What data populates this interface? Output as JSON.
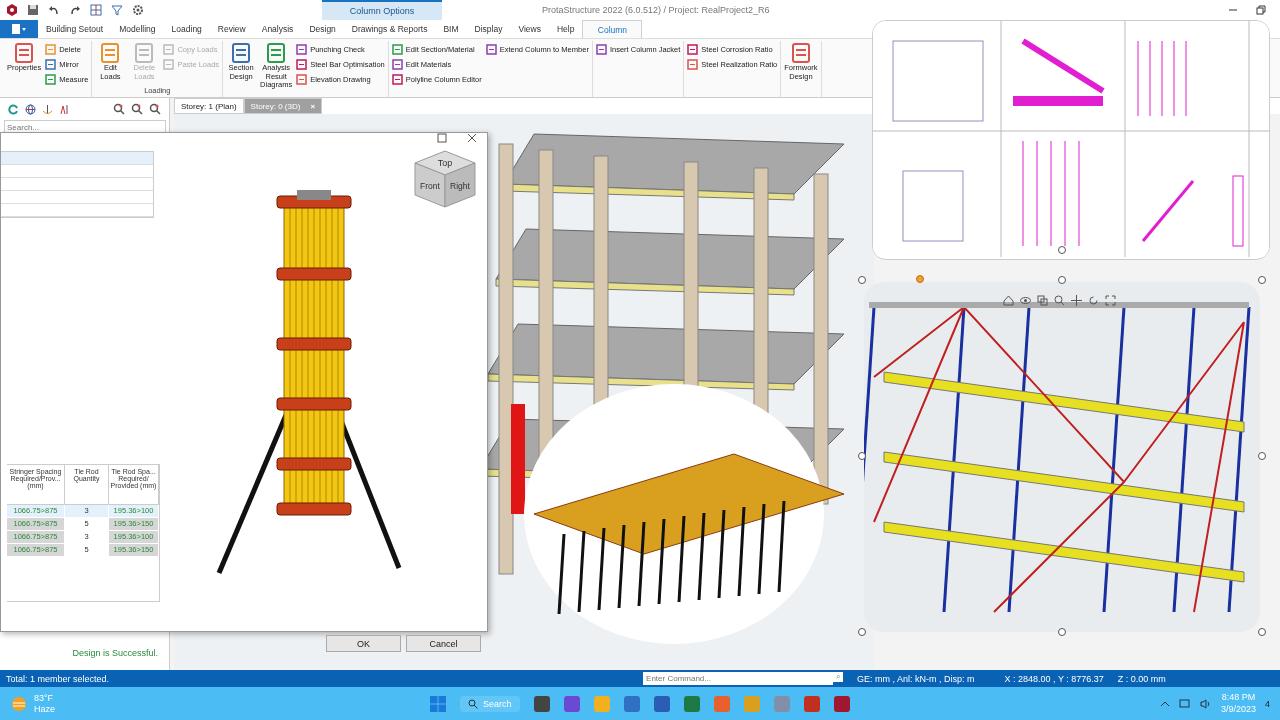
{
  "title_bar": {
    "context_header": "Column Options",
    "title": "ProtaStructure 2022 (6.0.512) / Project: RealProject2_R6"
  },
  "tabs": [
    {
      "label": "Building Setout",
      "selected": false
    },
    {
      "label": "Modelling",
      "selected": false
    },
    {
      "label": "Loading",
      "selected": false
    },
    {
      "label": "Review",
      "selected": false
    },
    {
      "label": "Analysis",
      "selected": false
    },
    {
      "label": "Design",
      "selected": false
    },
    {
      "label": "Drawings & Reports",
      "selected": false
    },
    {
      "label": "BIM",
      "selected": false
    },
    {
      "label": "Display",
      "selected": false
    },
    {
      "label": "Views",
      "selected": false
    },
    {
      "label": "Help",
      "selected": false
    },
    {
      "label": "Column",
      "selected": true
    }
  ],
  "ribbon": {
    "groups": [
      {
        "columns": [
          {
            "kind": "large",
            "items": [
              {
                "label": "Properties",
                "disabled": false
              }
            ]
          },
          {
            "kind": "stack",
            "items": [
              {
                "label": "Delete",
                "disabled": false
              },
              {
                "label": "Mirror",
                "disabled": false
              },
              {
                "label": "Measure",
                "disabled": false
              }
            ]
          }
        ]
      },
      {
        "label": "Loading",
        "columns": [
          {
            "kind": "large",
            "items": [
              {
                "label": "Edit Loads",
                "disabled": false
              }
            ]
          },
          {
            "kind": "large",
            "items": [
              {
                "label": "Delete Loads",
                "disabled": true
              }
            ]
          },
          {
            "kind": "stack",
            "items": [
              {
                "label": "Copy Loads",
                "disabled": true
              },
              {
                "label": "Paste Loads",
                "disabled": true
              }
            ]
          }
        ]
      },
      {
        "columns": [
          {
            "kind": "large",
            "items": [
              {
                "label": "Section Design",
                "disabled": false
              }
            ]
          },
          {
            "kind": "large",
            "items": [
              {
                "label": "Analysis Result Diagrams",
                "disabled": false
              }
            ]
          },
          {
            "kind": "stack",
            "items": [
              {
                "label": "Punching Check",
                "disabled": false
              },
              {
                "label": "Steel Bar Optimisation",
                "disabled": false
              },
              {
                "label": "Elevation Drawing",
                "disabled": false
              }
            ]
          }
        ]
      },
      {
        "columns": [
          {
            "kind": "stack",
            "items": [
              {
                "label": "Edit Section/Material",
                "disabled": false
              },
              {
                "label": "Edit Materials",
                "disabled": false
              },
              {
                "label": "Polyline Column Editor",
                "disabled": false
              }
            ]
          },
          {
            "kind": "stack",
            "items": [
              {
                "label": "Extend Column to Member",
                "disabled": false
              }
            ]
          }
        ]
      },
      {
        "columns": [
          {
            "kind": "stack",
            "items": [
              {
                "label": "Insert Column Jacket",
                "disabled": false
              }
            ]
          }
        ]
      },
      {
        "columns": [
          {
            "kind": "stack",
            "items": [
              {
                "label": "Steel Corrosion Ratio",
                "disabled": false
              },
              {
                "label": "Steel Realization Ratio",
                "disabled": false
              }
            ]
          }
        ]
      },
      {
        "columns": [
          {
            "kind": "large",
            "items": [
              {
                "label": "Formwork Design",
                "disabled": false
              }
            ]
          }
        ]
      }
    ]
  },
  "left_panel": {
    "search": {
      "placeholder": "Search..."
    }
  },
  "view_tabs": [
    {
      "label": "Storey: 1 (Plan)",
      "selected": false
    },
    {
      "label": "Storey: 0 (3D)",
      "selected": true,
      "close": "×"
    }
  ],
  "dialog": {
    "view_cube": [
      "Top",
      "Front",
      "Right"
    ],
    "table": {
      "columns": [
        "Stringer Spacing Required/Prov... (mm)",
        "Tie Rod Quantity",
        "Tie Rod Spa... Required/ Provided (mm)"
      ],
      "rows": [
        {
          "cells": [
            "1066.75>875",
            "3",
            "195.36>100"
          ],
          "selected": true
        },
        {
          "cells": [
            "1066.75>875",
            "5",
            "195.36>150"
          ],
          "selected": false
        },
        {
          "cells": [
            "1066.75>875",
            "3",
            "195.36>100"
          ],
          "selected": false
        },
        {
          "cells": [
            "1066.75>875",
            "5",
            "195.36>150"
          ],
          "selected": false
        }
      ]
    },
    "message": "Design is Successful.",
    "buttons": [
      "OK",
      "Cancel"
    ]
  },
  "status_bar": {
    "selection": "Total: 1 member selected.",
    "command": {
      "placeholder": "Enter Command..."
    },
    "units": "GE: mm , Anl: kN-m , Disp: m",
    "xy": "X : 2848.00 , Y : 8776.37",
    "z": "Z : 0.00 mm"
  },
  "taskbar": {
    "temperature": "83°F",
    "weather": "Haze",
    "search": "Search",
    "time": "8:48 PM",
    "date": "3/9/2023",
    "notifications": "4"
  }
}
